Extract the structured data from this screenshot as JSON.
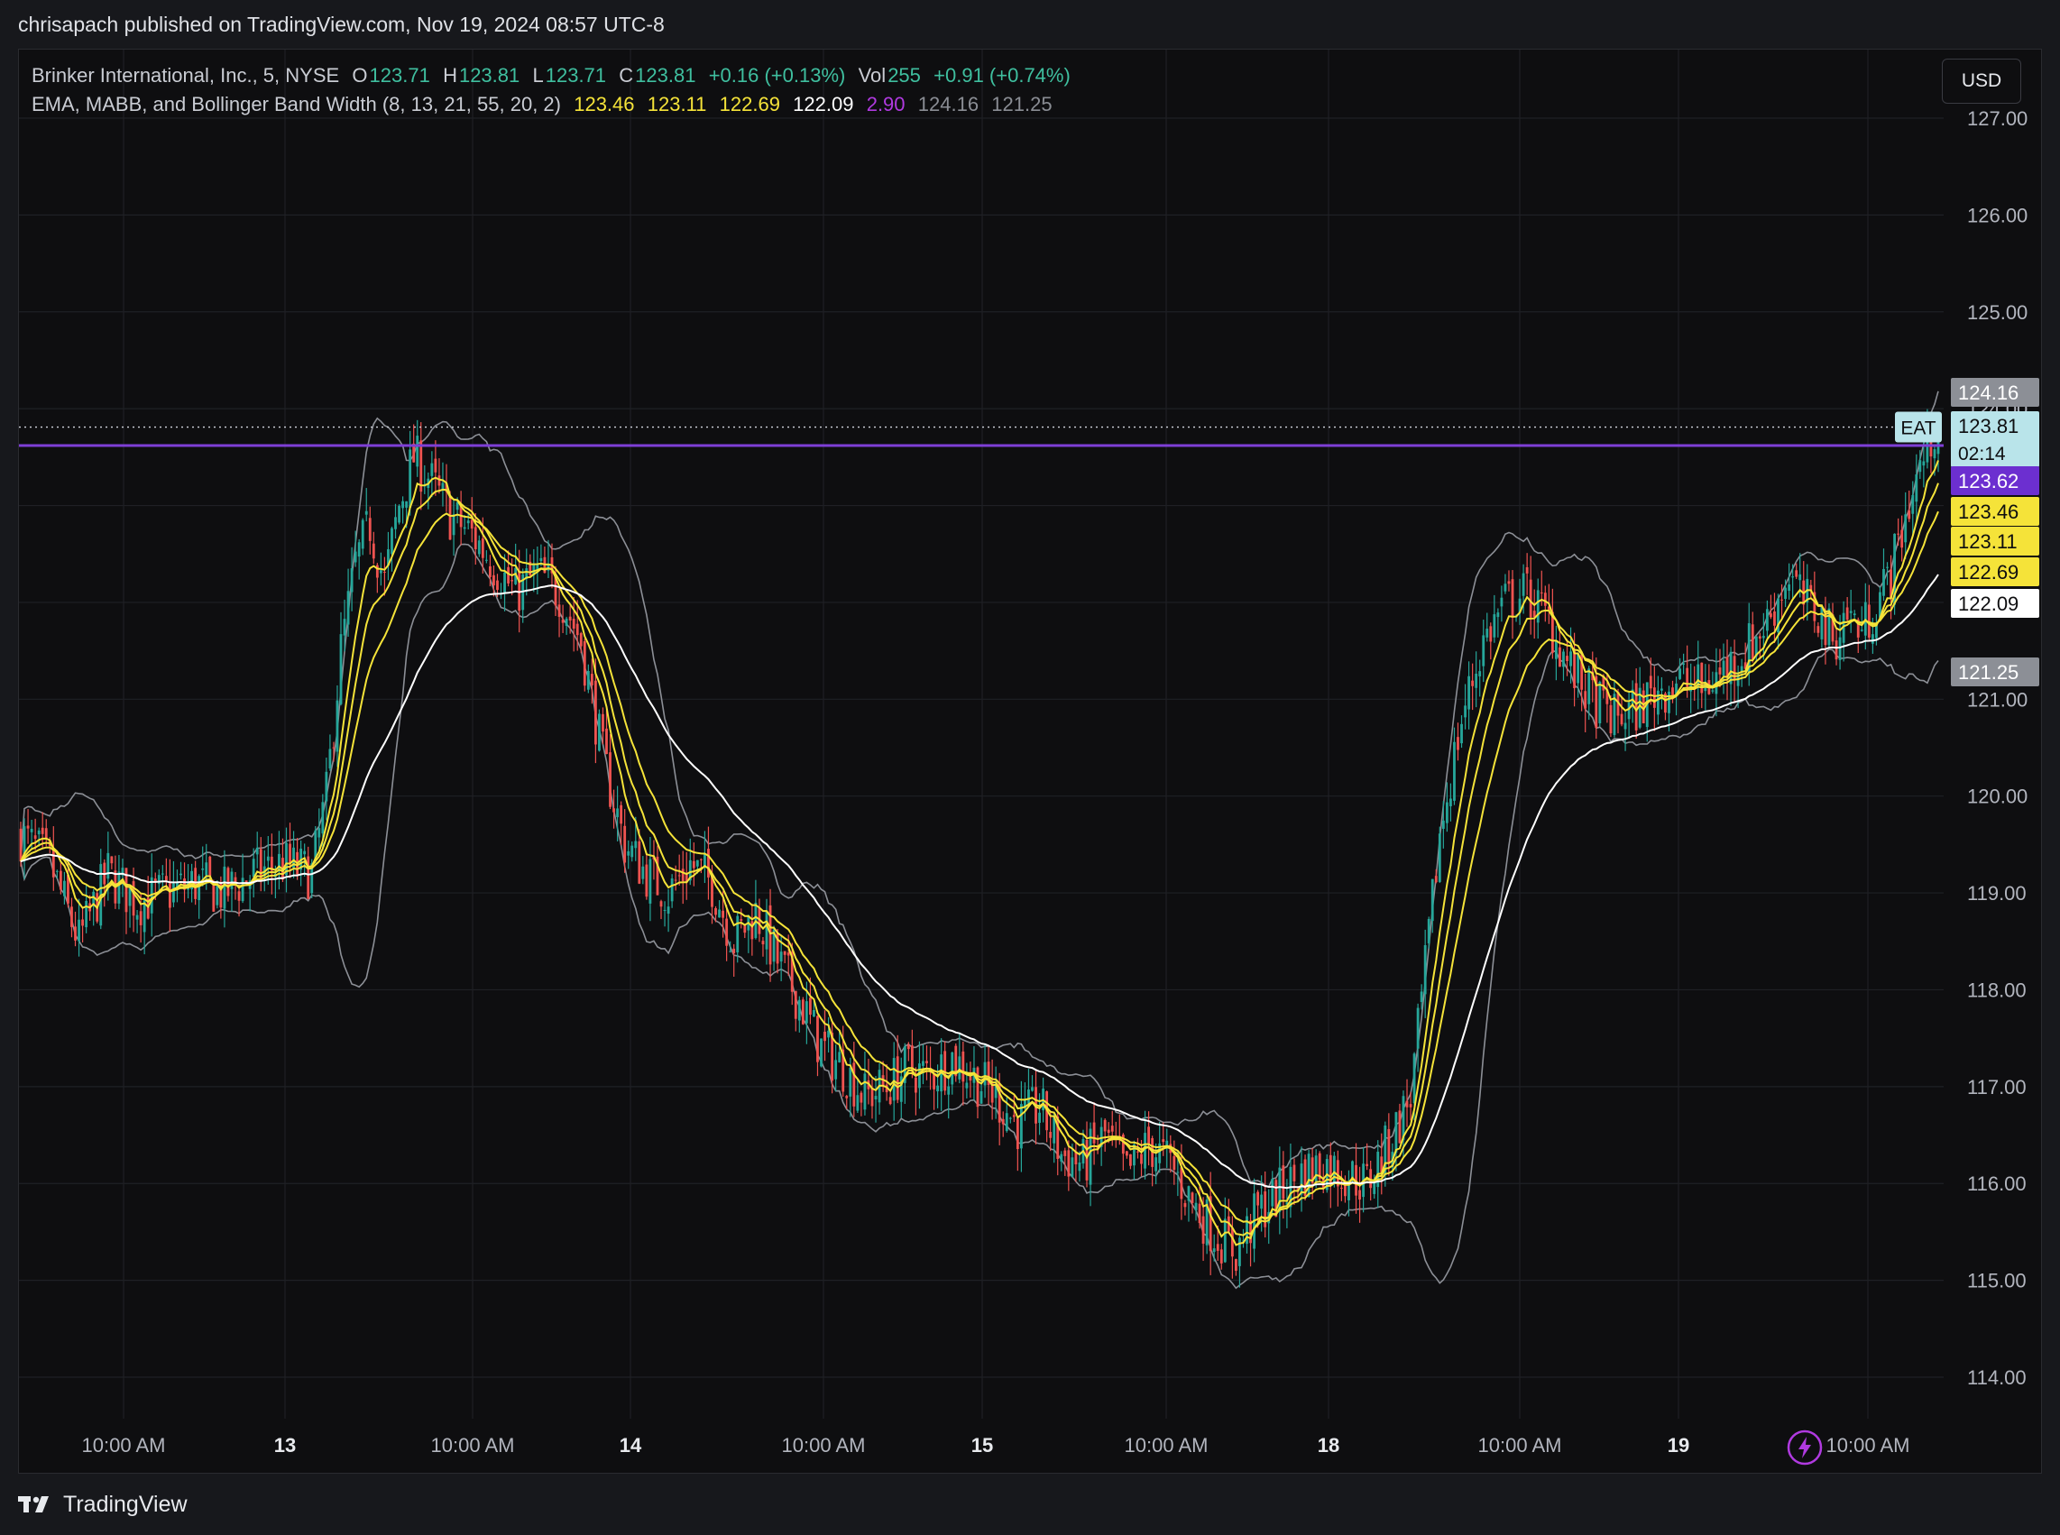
{
  "header": {
    "publisher_line": "chrisapach published on TradingView.com, Nov 19, 2024 08:57 UTC-8"
  },
  "legend": {
    "symbol": "Brinker International, Inc., 5, NYSE",
    "o_label": "O",
    "o_value": "123.71",
    "h_label": "H",
    "h_value": "123.81",
    "l_label": "L",
    "l_value": "123.71",
    "c_label": "C",
    "c_value": "123.81",
    "change": "+0.16 (+0.13%)",
    "vol_label": "Vol",
    "vol_value": "255",
    "vol_change": "+0.91 (+0.74%)",
    "indicator_name": "EMA, MABB, and Bollinger Band Width (8, 13, 21, 55, 20, 2)",
    "ema8": "123.46",
    "ema13": "123.11",
    "ema21": "122.69",
    "ema55": "122.09",
    "bbw": "2.90",
    "bb_upper": "124.16",
    "bb_lower": "121.25"
  },
  "toolbar": {
    "currency_button": "USD"
  },
  "footer": {
    "brand": "TradingView"
  },
  "icons": {
    "flash": "lightning-icon",
    "logo": "tradingview-logo-icon"
  },
  "colors": {
    "up": "#26a69a",
    "down": "#ef5350",
    "ema_fast": "#f5e339",
    "ema55": "#ffffff",
    "bands": "#8c8f96",
    "level": "#7e3fd6"
  },
  "chart_data": {
    "type": "candlestick",
    "symbol": "EAT",
    "interval": "5",
    "ylim": [
      113.6,
      127.4
    ],
    "y_ticks": [
      "114.00",
      "115.00",
      "116.00",
      "117.00",
      "118.00",
      "119.00",
      "120.00",
      "121.00",
      "122.00",
      "123.00",
      "124.00",
      "125.00",
      "126.00",
      "127.00"
    ],
    "x_ticks": [
      "10:00 AM",
      "13",
      "10:00 AM",
      "14",
      "10:00 AM",
      "15",
      "10:00 AM",
      "18",
      "10:00 AM",
      "19",
      "10:00 AM"
    ],
    "horizontal_line": 123.62,
    "last_price": 123.81,
    "countdown": "02:14",
    "price_labels": [
      {
        "text": "124.16",
        "value": 124.16,
        "role": "bb_upper"
      },
      {
        "text": "123.81",
        "value": 123.81,
        "role": "last"
      },
      {
        "text": "123.62",
        "value": 123.62,
        "role": "level"
      },
      {
        "text": "123.46",
        "value": 123.46,
        "role": "ema8"
      },
      {
        "text": "123.11",
        "value": 123.11,
        "role": "ema13"
      },
      {
        "text": "122.69",
        "value": 122.69,
        "role": "ema21"
      },
      {
        "text": "122.09",
        "value": 122.09,
        "role": "ema55"
      },
      {
        "text": "121.25",
        "value": 121.25,
        "role": "bb_lower"
      }
    ],
    "ticker_label": "EAT",
    "price_path": [
      [
        0,
        119.6
      ],
      [
        8,
        119.3
      ],
      [
        16,
        118.5
      ],
      [
        24,
        119.2
      ],
      [
        32,
        118.9
      ],
      [
        40,
        119.0
      ],
      [
        48,
        119.1
      ],
      [
        56,
        119.0
      ],
      [
        64,
        119.2
      ],
      [
        72,
        119.3
      ],
      [
        80,
        119.2
      ],
      [
        84,
        120.0
      ],
      [
        88,
        121.5
      ],
      [
        92,
        122.4
      ],
      [
        96,
        122.8
      ],
      [
        100,
        122.2
      ],
      [
        104,
        123.0
      ],
      [
        108,
        123.5
      ],
      [
        112,
        123.3
      ],
      [
        118,
        122.9
      ],
      [
        124,
        122.7
      ],
      [
        130,
        122.4
      ],
      [
        136,
        122.1
      ],
      [
        142,
        122.3
      ],
      [
        148,
        122.1
      ],
      [
        154,
        121.6
      ],
      [
        160,
        120.4
      ],
      [
        166,
        119.5
      ],
      [
        172,
        119.2
      ],
      [
        178,
        119.0
      ],
      [
        184,
        119.3
      ],
      [
        190,
        119.1
      ],
      [
        196,
        118.5
      ],
      [
        202,
        118.8
      ],
      [
        208,
        118.3
      ],
      [
        214,
        117.9
      ],
      [
        220,
        117.4
      ],
      [
        226,
        117.2
      ],
      [
        232,
        116.9
      ],
      [
        238,
        117.0
      ],
      [
        244,
        117.2
      ],
      [
        250,
        117.1
      ],
      [
        256,
        117.3
      ],
      [
        262,
        117.1
      ],
      [
        268,
        116.9
      ],
      [
        274,
        116.6
      ],
      [
        280,
        116.8
      ],
      [
        286,
        116.3
      ],
      [
        292,
        116.2
      ],
      [
        298,
        116.5
      ],
      [
        304,
        116.1
      ],
      [
        310,
        116.4
      ],
      [
        316,
        116.2
      ],
      [
        322,
        115.8
      ],
      [
        328,
        115.5
      ],
      [
        334,
        115.3
      ],
      [
        340,
        115.7
      ],
      [
        346,
        115.9
      ],
      [
        352,
        116.1
      ],
      [
        358,
        116.2
      ],
      [
        364,
        116.1
      ],
      [
        370,
        116.0
      ],
      [
        376,
        116.4
      ],
      [
        382,
        116.9
      ],
      [
        386,
        118.2
      ],
      [
        390,
        119.6
      ],
      [
        396,
        120.8
      ],
      [
        402,
        121.6
      ],
      [
        408,
        122.0
      ],
      [
        414,
        122.1
      ],
      [
        420,
        121.8
      ],
      [
        426,
        121.3
      ],
      [
        432,
        121.0
      ],
      [
        438,
        120.8
      ],
      [
        444,
        120.9
      ],
      [
        450,
        121.1
      ],
      [
        456,
        121.2
      ],
      [
        462,
        121.1
      ],
      [
        468,
        121.3
      ],
      [
        474,
        121.5
      ],
      [
        480,
        121.8
      ],
      [
        486,
        122.3
      ],
      [
        490,
        122.0
      ],
      [
        494,
        121.9
      ],
      [
        498,
        121.6
      ],
      [
        502,
        121.9
      ],
      [
        506,
        121.7
      ],
      [
        510,
        122.0
      ],
      [
        514,
        122.3
      ],
      [
        518,
        122.9
      ],
      [
        522,
        123.4
      ],
      [
        526,
        123.8
      ]
    ],
    "n_bars": 528
  }
}
